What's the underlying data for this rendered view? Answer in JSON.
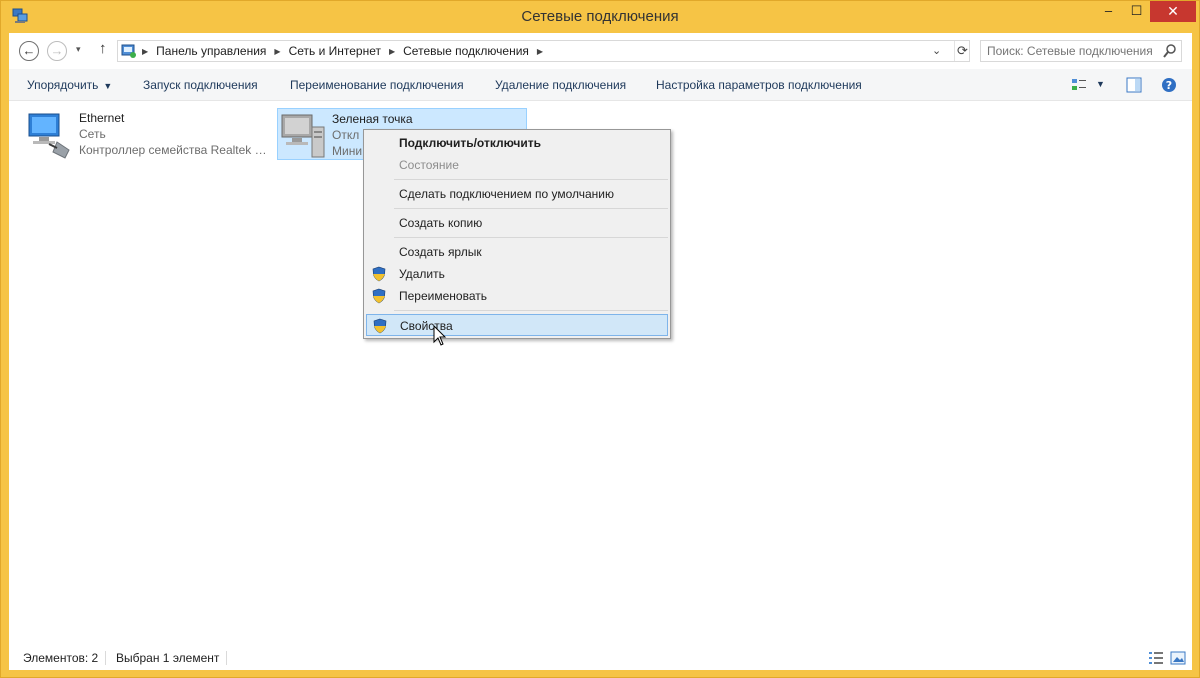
{
  "window": {
    "title": "Сетевые подключения",
    "controls": {
      "minimize": "‒",
      "maximize": "☐",
      "close": "✕"
    }
  },
  "navigation": {
    "back": "←",
    "forward": "→",
    "recent": "▾",
    "up": "↑",
    "breadcrumbs": [
      "Панель управления",
      "Сеть и Интернет",
      "Сетевые подключения"
    ],
    "crumb_separator": "▶",
    "dropdown": "⌄",
    "refresh": "⟳"
  },
  "search": {
    "placeholder": "Поиск: Сетевые подключения"
  },
  "toolbar": {
    "organize": "Упорядочить",
    "organize_arrow": "▼",
    "start_connection": "Запуск подключения",
    "rename_connection": "Переименование подключения",
    "delete_connection": "Удаление подключения",
    "configure_connection": "Настройка параметров подключения",
    "view_arrow": "▼"
  },
  "connections": [
    {
      "name": "Ethernet",
      "status": "Сеть",
      "device": "Контроллер семейства Realtek P...",
      "icon": "ethernet-adapter-icon"
    },
    {
      "name": "Зеленая точка",
      "status": "Откл",
      "device": "Мини",
      "icon": "disconnected-adapter-icon",
      "selected": true
    }
  ],
  "context_menu": {
    "items": [
      {
        "label": "Подключить/отключить",
        "bold": true
      },
      {
        "label": "Состояние",
        "disabled": true
      },
      {
        "label": "Сделать подключением по умолчанию"
      },
      {
        "label": "Создать копию"
      },
      {
        "label": "Создать ярлык"
      },
      {
        "label": "Удалить",
        "icon": "uac-shield-icon"
      },
      {
        "label": "Переименовать",
        "icon": "uac-shield-icon"
      },
      {
        "label": "Свойства",
        "icon": "uac-shield-icon",
        "highlighted": true
      }
    ]
  },
  "statusbar": {
    "item_count": "Элементов: 2",
    "selection": "Выбран 1 элемент"
  },
  "colors": {
    "window_frame": "#f6c445",
    "close_button": "#c7372f",
    "selection_bg": "#cce8ff",
    "menu_hover": "#d1e7f8",
    "toolbar_text": "#1e395b"
  }
}
